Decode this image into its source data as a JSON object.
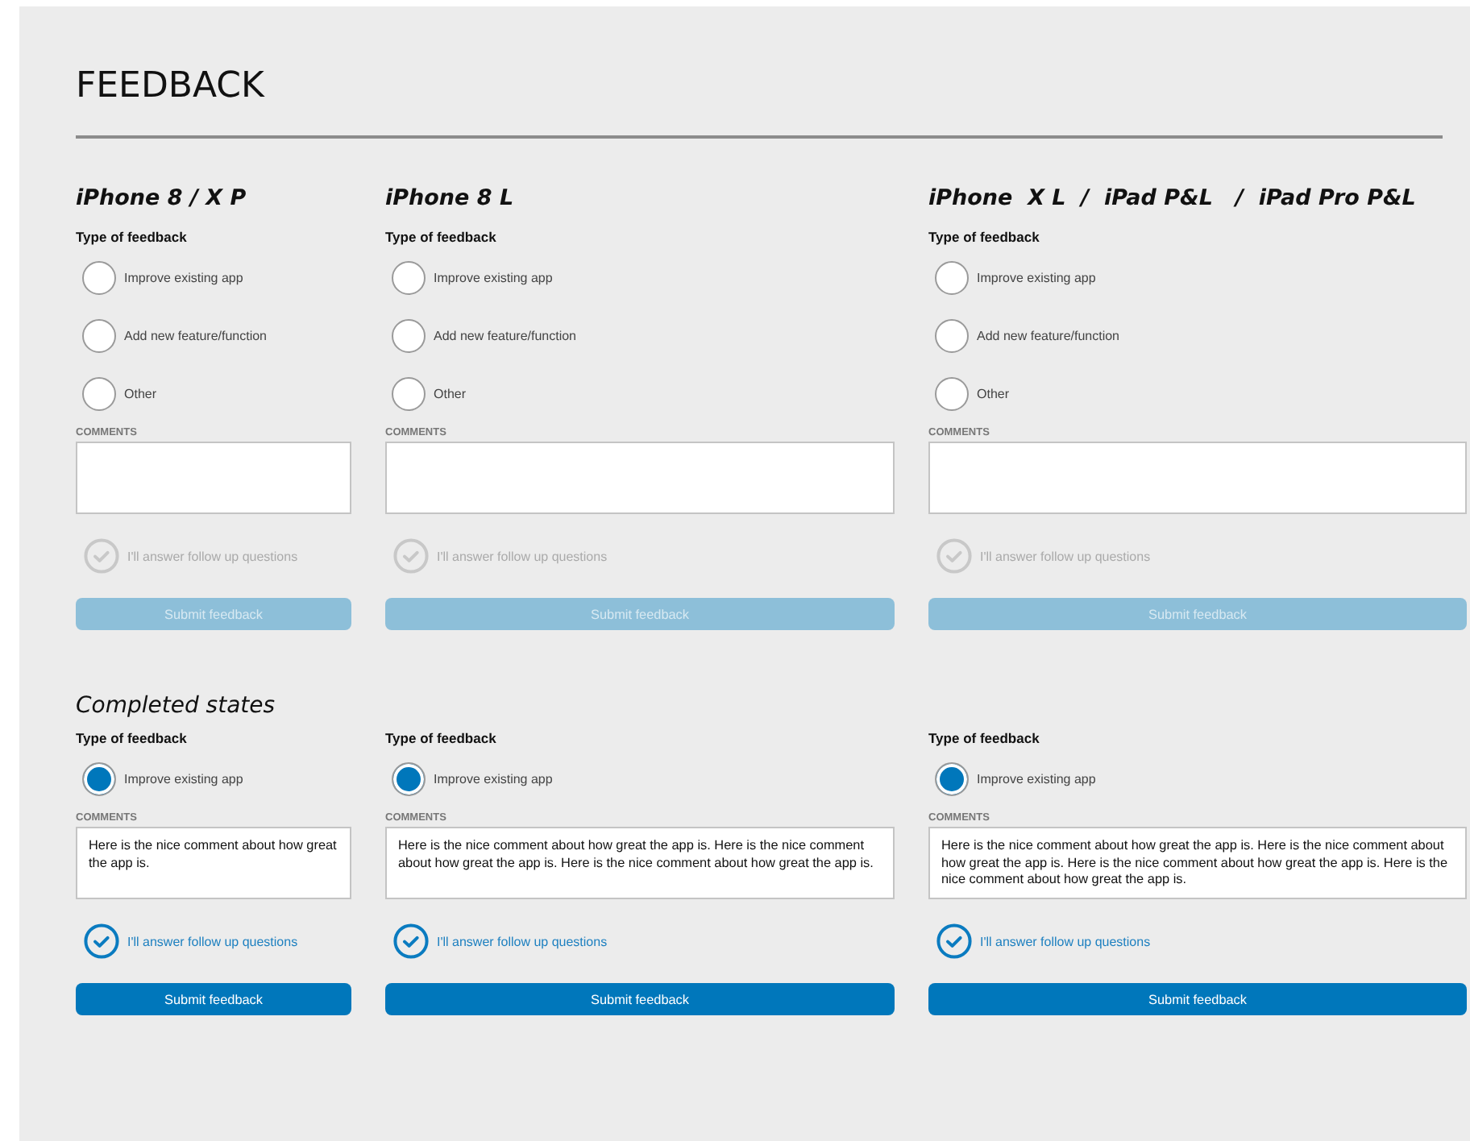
{
  "title": "FEEDBACK",
  "sections": [
    {
      "columns": [
        {
          "device": "iPhone 8 / X P",
          "type_label": "Type of feedback",
          "options": [
            {
              "label": "Improve existing app",
              "selected": false
            },
            {
              "label": "Add new feature/function",
              "selected": false
            },
            {
              "label": "Other",
              "selected": false
            }
          ],
          "comments_label": "COMMENTS",
          "follow_up": {
            "label": "I'll answer follow up questions",
            "checked": false
          },
          "submit": {
            "label": "Submit feedback",
            "disabled": true
          }
        },
        {
          "device": "iPhone 8 L",
          "type_label": "Type of feedback",
          "options": [
            {
              "label": "Improve existing app",
              "selected": false
            },
            {
              "label": "Add new feature/function",
              "selected": false
            },
            {
              "label": "Other",
              "selected": false
            }
          ],
          "comments_label": "COMMENTS",
          "follow_up": {
            "label": "I'll answer follow up questions",
            "checked": false
          },
          "submit": {
            "label": "Submit feedback",
            "disabled": true
          }
        },
        {
          "device": "iPhone  X L  /  iPad P&L   /  iPad Pro P&L",
          "type_label": "Type of feedback",
          "options": [
            {
              "label": "Improve existing app",
              "selected": false
            },
            {
              "label": "Add new feature/function",
              "selected": false
            },
            {
              "label": "Other",
              "selected": false
            }
          ],
          "comments_label": "COMMENTS",
          "follow_up": {
            "label": "I'll answer follow up questions",
            "checked": false
          },
          "submit": {
            "label": "Submit feedback",
            "disabled": true
          }
        }
      ]
    },
    {
      "heading": "Completed states",
      "columns": [
        {
          "type_label": "Type of feedback",
          "options": [
            {
              "label": "Improve existing app",
              "selected": true
            }
          ],
          "comments_label": "COMMENTS",
          "comment": "Here is the nice comment about how great the app is.",
          "follow_up": {
            "label": "I'll answer follow up questions",
            "checked": true
          },
          "submit": {
            "label": "Submit feedback",
            "disabled": false
          }
        },
        {
          "type_label": "Type of feedback",
          "options": [
            {
              "label": "Improve existing app",
              "selected": true
            }
          ],
          "comments_label": "COMMENTS",
          "comment": "Here is the nice comment about how great the app is. Here is the nice comment about how great the app is. Here is the nice comment about how great the app is.",
          "follow_up": {
            "label": "I'll answer follow up questions",
            "checked": true
          },
          "submit": {
            "label": "Submit feedback",
            "disabled": false
          }
        },
        {
          "type_label": "Type of feedback",
          "options": [
            {
              "label": "Improve existing app",
              "selected": true
            }
          ],
          "comments_label": "COMMENTS",
          "comment": "Here is the nice comment about how great the app is. Here is the nice comment about how great the app is. Here is the nice comment about how great the app is. Here is the nice comment about how great the app is.",
          "follow_up": {
            "label": "I'll answer follow up questions",
            "checked": true
          },
          "submit": {
            "label": "Submit feedback",
            "disabled": false
          }
        }
      ]
    }
  ]
}
